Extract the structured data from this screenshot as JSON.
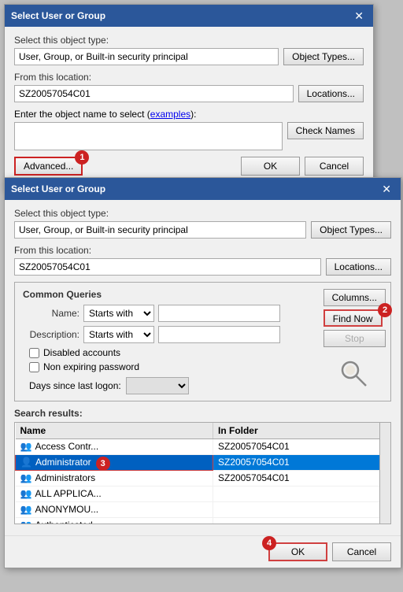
{
  "dialog1": {
    "title": "Select User or Group",
    "objectTypeLabel": "Select this object type:",
    "objectTypeValue": "User, Group, or Built-in security principal",
    "locationLabel": "From this location:",
    "locationValue": "SZ20057054C01",
    "objectNameLabel": "Enter the object name to select",
    "examplesLink": "examples",
    "objectNameValue": "",
    "btnObjectTypes": "Object Types...",
    "btnLocations": "Locations...",
    "btnCheckNames": "Check Names",
    "btnAdvanced": "Advanced...",
    "btnOK": "OK",
    "btnCancel": "Cancel",
    "badge1": "1"
  },
  "dialog2": {
    "title": "Select User or Group",
    "objectTypeLabel": "Select this object type:",
    "objectTypeValue": "User, Group, or Built-in security principal",
    "locationLabel": "From this location:",
    "locationValue": "SZ20057054C01",
    "btnObjectTypes": "Object Types...",
    "btnLocations": "Locations...",
    "commonQueriesTitle": "Common Queries",
    "nameLabel": "Name:",
    "descriptionLabel": "Description:",
    "nameStartsWith": "Starts with",
    "descStartsWith": "Starts with",
    "nameValue": "",
    "descValue": "",
    "disabledAccounts": "Disabled accounts",
    "nonExpiringPassword": "Non expiring password",
    "daysLabel": "Days since last logon:",
    "daysValue": "",
    "btnColumns": "Columns...",
    "btnFindNow": "Find Now",
    "btnStop": "Stop",
    "badge2": "2",
    "searchResultsLabel": "Search results:",
    "colName": "Name",
    "colInFolder": "In Folder",
    "results": [
      {
        "icon": "👥",
        "name": "Access Contr...",
        "folder": "SZ20057054C01",
        "selected": false
      },
      {
        "icon": "👤",
        "name": "Administrator",
        "folder": "SZ20057054C01",
        "selected": true
      },
      {
        "icon": "👥",
        "name": "Administrators",
        "folder": "SZ20057054C01",
        "selected": false
      },
      {
        "icon": "👥",
        "name": "ALL APPLICA...",
        "folder": "",
        "selected": false
      },
      {
        "icon": "👥",
        "name": "ANONYMOU...",
        "folder": "",
        "selected": false
      },
      {
        "icon": "👥",
        "name": "Authenticated...",
        "folder": "",
        "selected": false
      }
    ],
    "badge3": "3",
    "badge4": "4",
    "btnOK": "OK",
    "btnCancel": "Cancel"
  }
}
